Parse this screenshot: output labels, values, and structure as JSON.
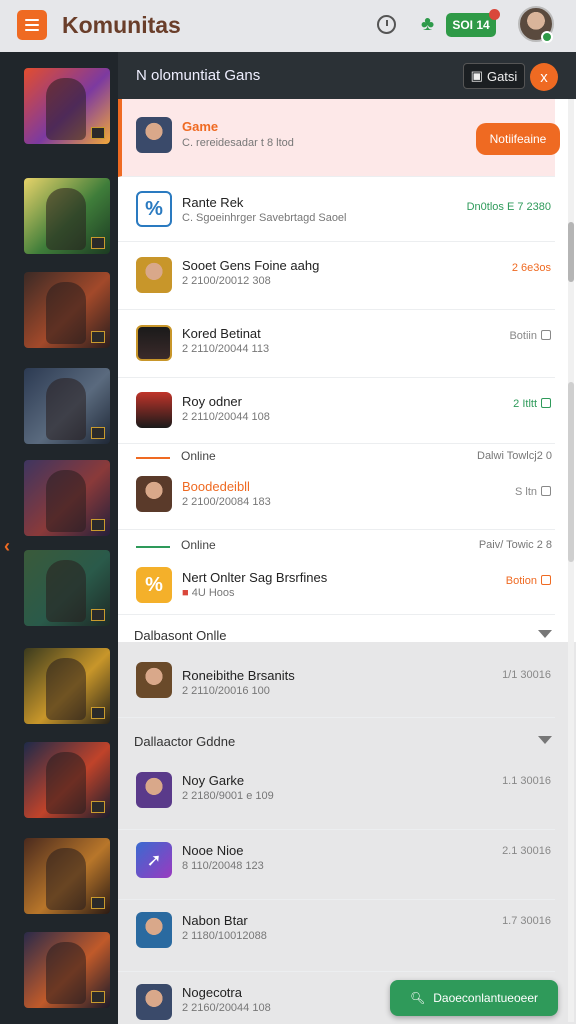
{
  "app": {
    "title": "Komunitas",
    "coins": "SOI 14"
  },
  "panel": {
    "title": "N olomuntiat Gans",
    "games_button": "Gatsi",
    "close_label": "x"
  },
  "featured": {
    "name": "Game",
    "sub": "C. rereidesadar t 8 ltod",
    "button": "Notiifeaine"
  },
  "rows": [
    {
      "name": "Rante Rek",
      "sub": "C. Sgoeinhrger Savebrtagd Saoel",
      "right": "Dn0tlos E 7 2380",
      "right_color": "#2e9a5a"
    },
    {
      "name": "Sooet Gens Foine aahg",
      "sub": "2 2100/20012 308",
      "right": "2 6e3os",
      "right_color": "#ef6a22"
    },
    {
      "name": "Kored Betinat",
      "sub": "2 2110/20044 113",
      "right": "Botiin",
      "right_color": "#777"
    },
    {
      "name": "Roy odner",
      "sub": "2 2110/20044 108",
      "right": "2 Itltt",
      "right_color": "#2e9a5a"
    }
  ],
  "section1": {
    "label": "Online",
    "right": "Dalwi Towlcj2 0"
  },
  "row5": {
    "name": "Boodedeibll",
    "sub": "2 2100/20084 183",
    "right": "S ltn"
  },
  "section2": {
    "label": "Online",
    "right": "Paiv/ Towic 2 8"
  },
  "row6": {
    "name": "Nert Onlter Sag Brsrfines",
    "sub": "4U Hoos",
    "right": "Botion"
  },
  "dropdown1": {
    "label": "Dalbasont Onlle"
  },
  "row7": {
    "name": "Roneibithe Brsanits",
    "sub": "2 2110/20016 100",
    "right": "1/1 30016"
  },
  "dropdown2": {
    "label": "Dallaactor Gddne"
  },
  "lower_rows": [
    {
      "name": "Noy Garke",
      "sub": "2 2180/9001 e 109",
      "right": "1.1 30016"
    },
    {
      "name": "Nooe Nioe",
      "sub": "8 110/20048 123",
      "right": "2.1 30016"
    },
    {
      "name": "Nabon Btar",
      "sub": "2 1180/10012088",
      "right": "1.7 30016"
    },
    {
      "name": "Nogecotra",
      "sub": "2 2160/20044 108",
      "right": ""
    }
  ],
  "fab": {
    "label": "Daoeconlantueoeer"
  }
}
